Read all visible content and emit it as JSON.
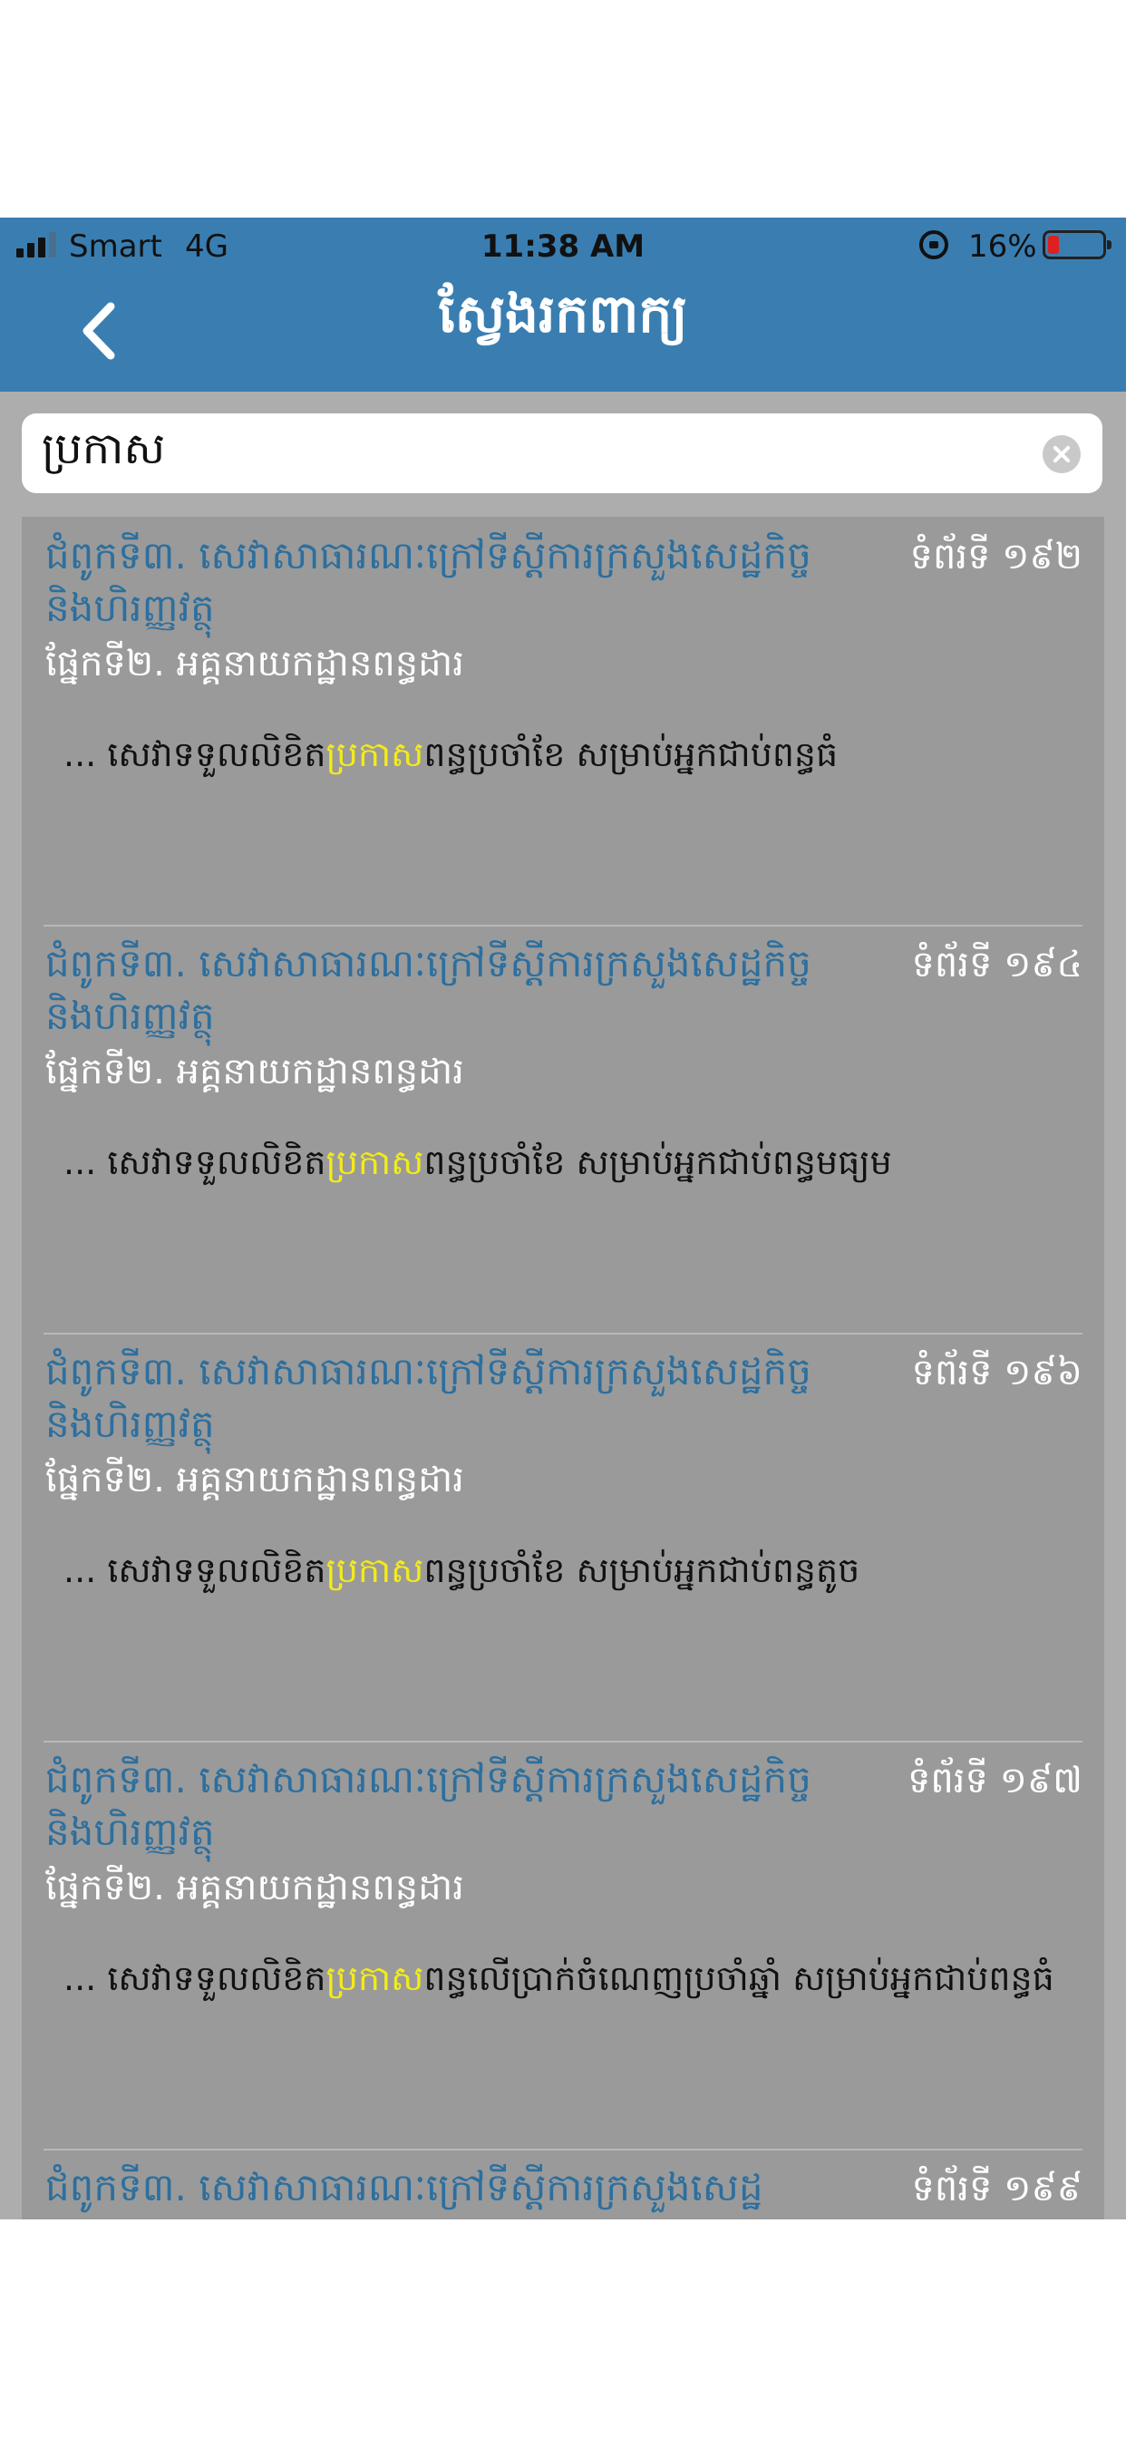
{
  "status_bar": {
    "carrier": "Smart",
    "network": "4G",
    "time": "11:38 AM",
    "battery": "16%"
  },
  "nav": {
    "title": "ស្វែងរកពាក្យ",
    "back_icon": "chevron-left-icon"
  },
  "search": {
    "value": "ប្រកាស",
    "clear_icon": "clear-icon"
  },
  "results": [
    {
      "title": "ជំពូកទី៣. សេវាសាធារណៈក្រៅទីស្តីការក្រសួងសេដ្ឋកិច្ចនិងហិរញ្ញវត្ថុ",
      "page": "ទំព័រទី ១៩២",
      "section": "ផ្នែកទី២. អគ្គនាយកដ្ឋានពន្ធដារ",
      "snippet_before": "... សេវាទទួលលិខិត",
      "snippet_match": "ប្រកាស",
      "snippet_after": "ពន្ធប្រចាំខែ សម្រាប់អ្នកជាប់ពន្ធធំ"
    },
    {
      "title": "ជំពូកទី៣. សេវាសាធារណៈក្រៅទីស្តីការក្រសួងសេដ្ឋកិច្ចនិងហិរញ្ញវត្ថុ",
      "page": "ទំព័រទី ១៩៤",
      "section": "ផ្នែកទី២. អគ្គនាយកដ្ឋានពន្ធដារ",
      "snippet_before": "... សេវាទទួលលិខិត",
      "snippet_match": "ប្រកាស",
      "snippet_after": "ពន្ធប្រចាំខែ សម្រាប់អ្នកជាប់ពន្ធមធ្យម"
    },
    {
      "title": "ជំពូកទី៣. សេវាសាធារណៈក្រៅទីស្តីការក្រសួងសេដ្ឋកិច្ចនិងហិរញ្ញវត្ថុ",
      "page": "ទំព័រទី ១៩៦",
      "section": "ផ្នែកទី២. អគ្គនាយកដ្ឋានពន្ធដារ",
      "snippet_before": "... សេវាទទួលលិខិត",
      "snippet_match": "ប្រកាស",
      "snippet_after": "ពន្ធប្រចាំខែ សម្រាប់អ្នកជាប់ពន្ធតូច"
    },
    {
      "title": "ជំពូកទី៣. សេវាសាធារណៈក្រៅទីស្តីការក្រសួងសេដ្ឋកិច្ចនិងហិរញ្ញវត្ថុ",
      "page": "ទំព័រទី ១៩៧",
      "section": "ផ្នែកទី២. អគ្គនាយកដ្ឋានពន្ធដារ",
      "snippet_before": "... សេវាទទួលលិខិត",
      "snippet_match": "ប្រកាស",
      "snippet_after": "ពន្ធលើប្រាក់ចំណេញប្រចាំឆ្នាំ សម្រាប់អ្នកជាប់ពន្ធធំ"
    },
    {
      "title": "ជំពូកទី៣. សេវាសាធារណៈក្រៅទីស្តីការក្រសួងសេដ្ឋ",
      "page": "ទំព័រទី ១៩៩",
      "section": "",
      "snippet_before": "",
      "snippet_match": "",
      "snippet_after": ""
    }
  ],
  "colors": {
    "nav_bg": "#3a7eb1",
    "title_text": "#2d6f9e",
    "highlight": "#f3ea1a",
    "list_bg": "#9a9a9a"
  }
}
